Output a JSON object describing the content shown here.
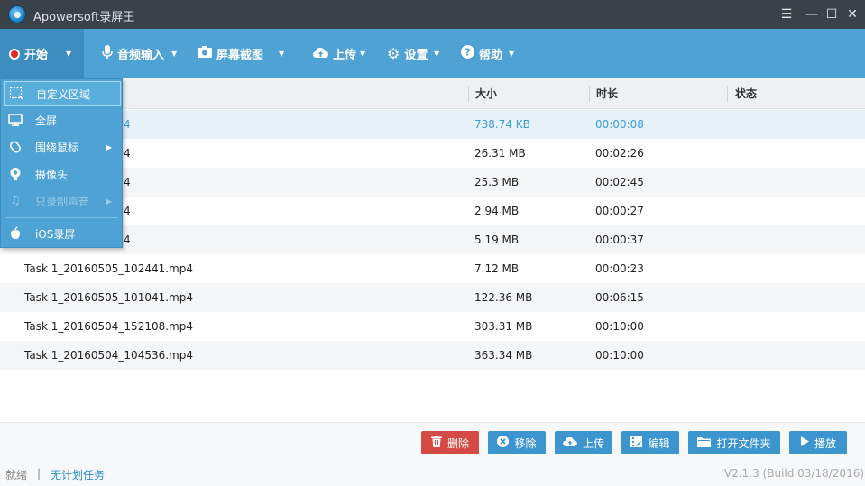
{
  "app": {
    "title": "Apowersoft录屏王"
  },
  "window_controls": {
    "menu": "☰",
    "minimize": "—",
    "maximize": "☐",
    "close": "✕"
  },
  "toolbar": {
    "start": "开始",
    "audio_input": "音频输入",
    "screenshot": "屏幕截图",
    "upload": "上传",
    "settings": "设置",
    "help": "帮助"
  },
  "table": {
    "columns": {
      "size": "大小",
      "duration": "时长",
      "status": "状态"
    },
    "rows": [
      {
        "name": "4",
        "size": "738.74 KB",
        "duration": "00:00:08"
      },
      {
        "name": "4",
        "size": "26.31 MB",
        "duration": "00:02:26"
      },
      {
        "name": "4",
        "size": "25.3 MB",
        "duration": "00:02:45"
      },
      {
        "name": "4",
        "size": "2.94 MB",
        "duration": "00:00:27"
      },
      {
        "name": "4",
        "size": "5.19 MB",
        "duration": "00:00:37"
      },
      {
        "name": "Task 1_20160505_102441.mp4",
        "size": "7.12 MB",
        "duration": "00:00:23"
      },
      {
        "name": "Task 1_20160505_101041.mp4",
        "size": "122.36 MB",
        "duration": "00:06:15"
      },
      {
        "name": "Task 1_20160504_152108.mp4",
        "size": "303.31 MB",
        "duration": "00:10:00"
      },
      {
        "name": "Task 1_20160504_104536.mp4",
        "size": "363.34 MB",
        "duration": "00:10:00"
      }
    ]
  },
  "start_menu": {
    "items": [
      {
        "label": "自定义区域",
        "icon": "region-select-icon"
      },
      {
        "label": "全屏",
        "icon": "monitor-icon"
      },
      {
        "label": "围绕鼠标",
        "icon": "mouse-icon"
      },
      {
        "label": "摄像头",
        "icon": "webcam-icon"
      },
      {
        "label": "只录制声音",
        "icon": "music-note-icon"
      },
      {
        "label": "iOS录屏",
        "icon": "apple-icon"
      }
    ]
  },
  "actions": {
    "delete": "删除",
    "remove": "移除",
    "upload": "上传",
    "edit": "编辑",
    "open_folder": "打开文件夹",
    "play": "播放"
  },
  "status_bar": {
    "ready": "就绪",
    "separator": "|",
    "schedule": "无计划任务",
    "version": "V2.1.3 (Build 03/18/2016)"
  }
}
